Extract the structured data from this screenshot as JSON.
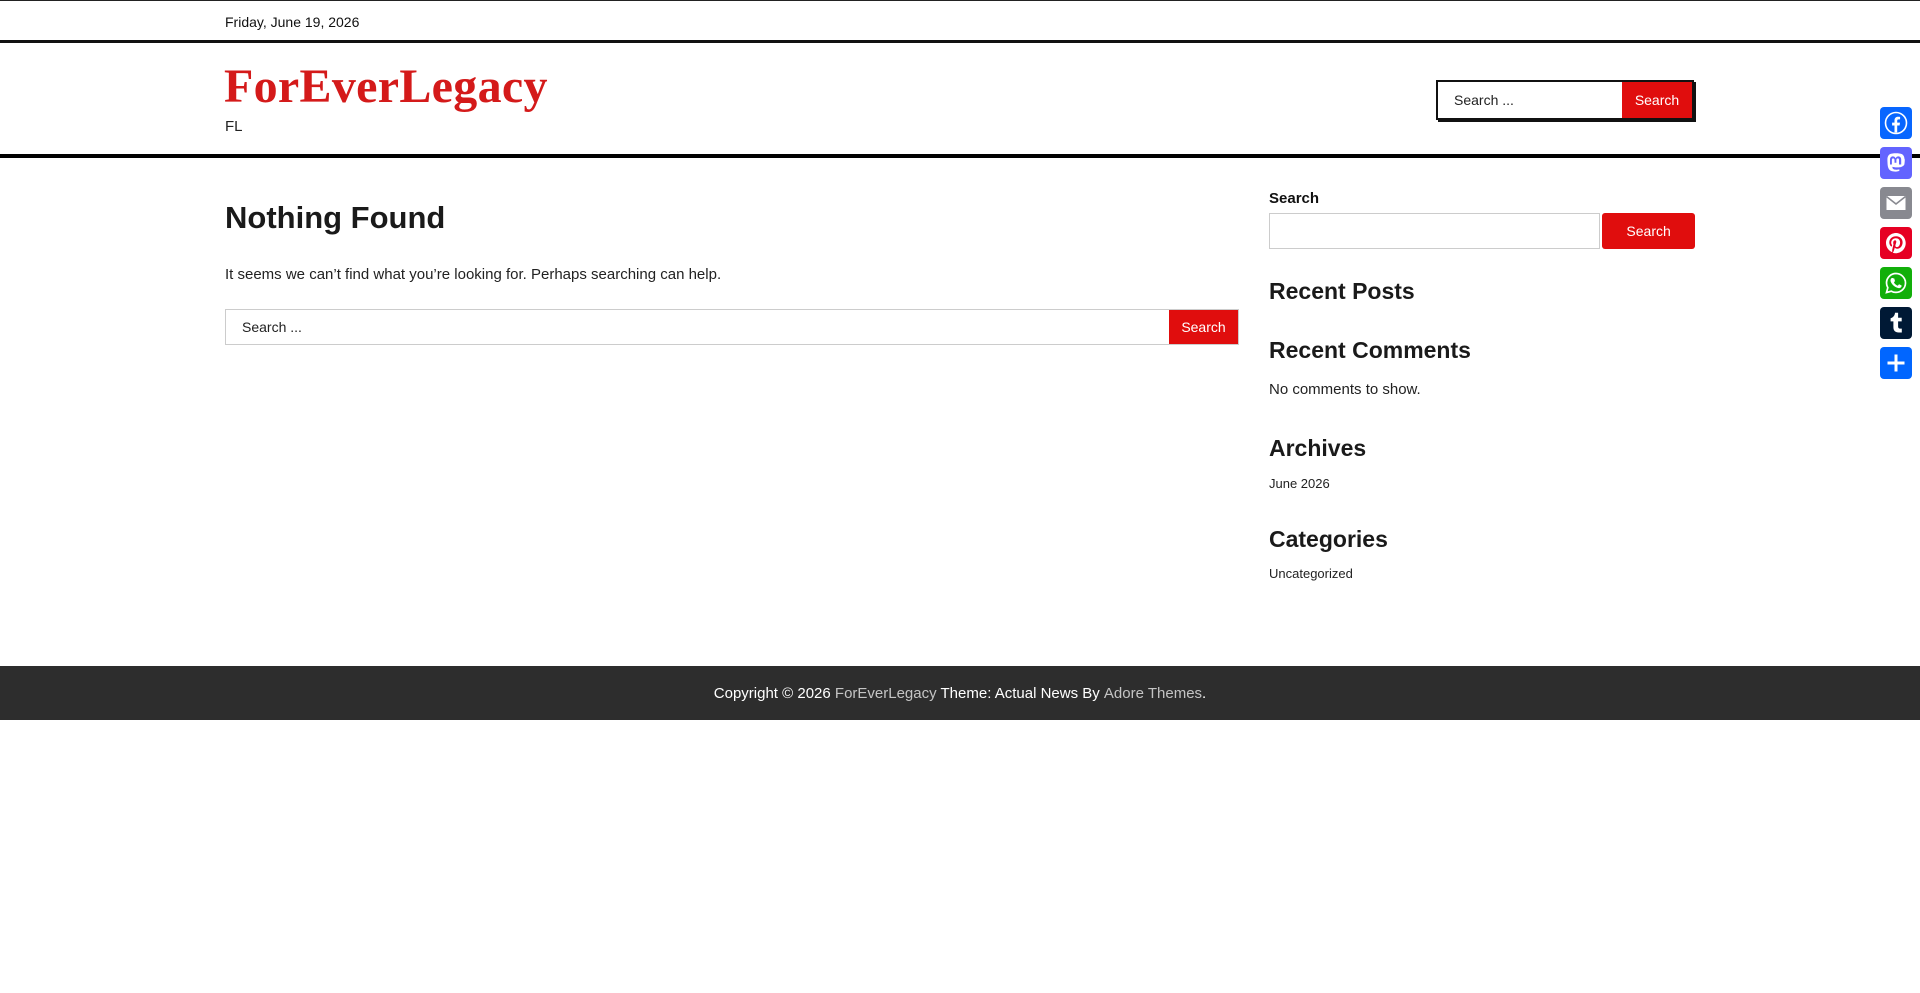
{
  "topbar": {
    "date": "Friday, June 19, 2026"
  },
  "header": {
    "site_title": "ForEverLegacy",
    "tagline": "FL",
    "search": {
      "placeholder": "Search ...",
      "button_label": "Search"
    }
  },
  "main": {
    "title": "Nothing Found",
    "message": "It seems we can’t find what you’re looking for. Perhaps searching can help.",
    "search": {
      "placeholder": "Search ...",
      "button_label": "Search"
    }
  },
  "sidebar": {
    "search": {
      "label": "Search",
      "value": "",
      "button_label": "Search"
    },
    "recent_posts": {
      "heading": "Recent Posts"
    },
    "recent_comments": {
      "heading": "Recent Comments",
      "empty_text": "No comments to show."
    },
    "archives": {
      "heading": "Archives",
      "items": [
        "June 2026"
      ]
    },
    "categories": {
      "heading": "Categories",
      "items": [
        "Uncategorized"
      ]
    }
  },
  "footer": {
    "copyright": "Copyright © 2026 ",
    "site_link": "ForEverLegacy",
    "theme_text": " Theme: Actual News By ",
    "theme_author": "Adore Themes",
    "end": "."
  },
  "share": [
    {
      "name": "Facebook",
      "icon": "facebook-icon",
      "color": "#0866ff"
    },
    {
      "name": "Mastodon",
      "icon": "mastodon-icon",
      "color": "#6364ff"
    },
    {
      "name": "Email",
      "icon": "email-icon",
      "color": "#888990"
    },
    {
      "name": "Pinterest",
      "icon": "pinterest-icon",
      "color": "#e60023"
    },
    {
      "name": "WhatsApp",
      "icon": "whatsapp-icon",
      "color": "#12af0a"
    },
    {
      "name": "Tumblr",
      "icon": "tumblr-icon",
      "color": "#001935"
    },
    {
      "name": "Share",
      "icon": "share-plus-icon",
      "color": "#0166ff"
    }
  ],
  "colors": {
    "accent": "#e00d0d",
    "title": "#d41a1a",
    "footer_bg": "#2d2d2d"
  }
}
